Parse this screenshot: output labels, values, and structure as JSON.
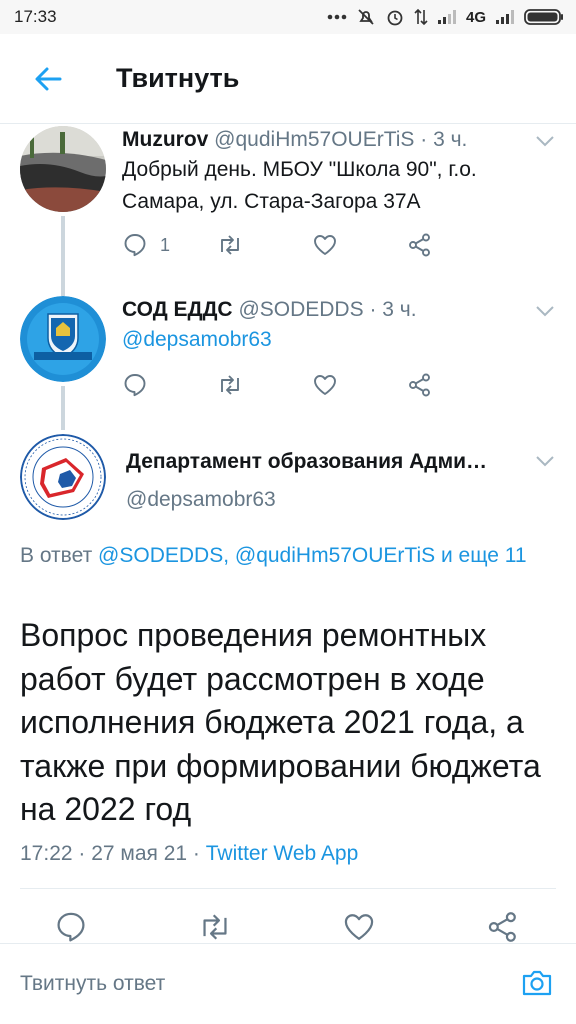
{
  "status_bar": {
    "time": "17:33",
    "network": "4G"
  },
  "header": {
    "title": "Твитнуть"
  },
  "tweets": [
    {
      "name": "Muzurov",
      "meta": "@qudiHm57OUErTiS · 3 ч.",
      "text": "Добрый день. МБОУ \"Школа 90\", г.о. Самара, ул. Стара-Загора 37А",
      "reply_count": "1"
    },
    {
      "name": "СОД ЕДДС",
      "meta": "@SODEDDS · 3 ч.",
      "text": "@depsamobr63"
    }
  ],
  "main_tweet": {
    "name": "Департамент образования Адми…",
    "handle": "@depsamobr63",
    "reply_prefix": "В ответ ",
    "reply_links": "@SODEDDS, @qudiHm57OUErTiS и еще 11",
    "text": "Вопрос проведения ремонтных работ будет рассмотрен в ходе исполнения бюджета 2021 года, а также при формировании бюджета на 2022 год",
    "time": "17:22 · 27 мая 21 · ",
    "source": "Twitter Web App"
  },
  "reply_bar": {
    "placeholder": "Твитнуть ответ"
  },
  "colors": {
    "accent": "#1da1f2",
    "text": "#14171a",
    "secondary": "#657786",
    "divider": "#e6ecf0"
  }
}
